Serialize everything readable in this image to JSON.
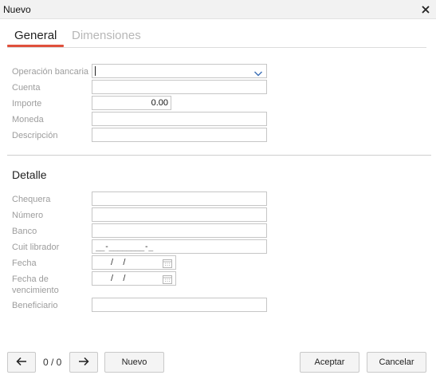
{
  "window": {
    "title": "Nuevo"
  },
  "tabs": [
    {
      "label": "General",
      "active": true
    },
    {
      "label": "Dimensiones",
      "active": false
    }
  ],
  "general": {
    "operacion_label": "Operación bancaria",
    "operacion_value": "",
    "cuenta_label": "Cuenta",
    "cuenta_value": "",
    "importe_label": "Importe",
    "importe_value": "0.00",
    "moneda_label": "Moneda",
    "moneda_value": "",
    "descripcion_label": "Descripción",
    "descripcion_value": ""
  },
  "detalle": {
    "title": "Detalle",
    "chequera_label": "Chequera",
    "chequera_value": "",
    "numero_label": "Número",
    "numero_value": "",
    "banco_label": "Banco",
    "banco_value": "",
    "cuit_label": "Cuit librador",
    "cuit_mask": "__-________-_",
    "fecha_label": "Fecha",
    "fecha_mask": " /    /",
    "fecha_venc_label_1": "Fecha de",
    "fecha_venc_label_2": "vencimiento",
    "fecha_venc_mask": " /    /",
    "beneficiario_label": "Beneficiario",
    "beneficiario_value": ""
  },
  "footer": {
    "pager": "0 / 0",
    "nuevo_label": "Nuevo",
    "aceptar_label": "Aceptar",
    "cancelar_label": "Cancelar"
  },
  "colors": {
    "accent": "#e0503c",
    "label": "#9d9d9d",
    "border": "#c6c6c6",
    "inactive_tab": "#b7b7b7",
    "chevron": "#3b6fb6"
  },
  "icons": [
    "close-icon",
    "chevron-down-icon",
    "calendar-icon",
    "arrow-left-icon",
    "arrow-right-icon"
  ]
}
